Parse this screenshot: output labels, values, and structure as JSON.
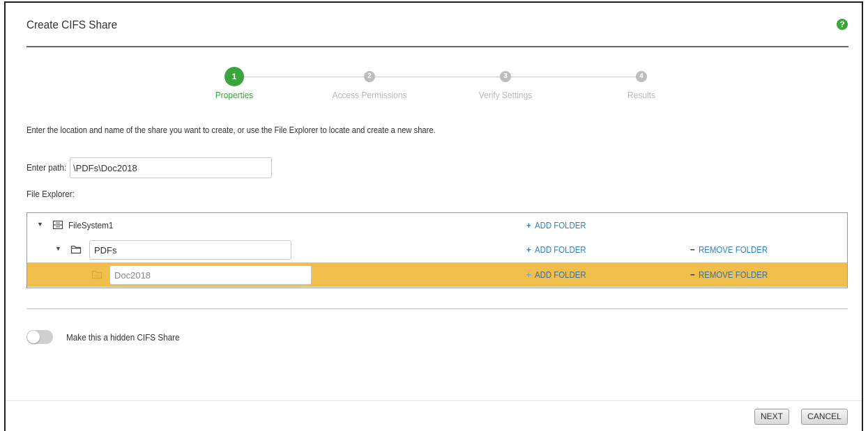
{
  "dialog": {
    "title": "Create CIFS Share",
    "help_icon": "question-icon",
    "help_symbol": "?"
  },
  "stepper": {
    "steps": [
      {
        "number": "1",
        "label": "Properties",
        "state": "active"
      },
      {
        "number": "2",
        "label": "Access Permissions",
        "state": "inactive"
      },
      {
        "number": "3",
        "label": "Verify Settings",
        "state": "inactive"
      },
      {
        "number": "4",
        "label": "Results",
        "state": "inactive"
      }
    ],
    "active_color": "#3aa53a",
    "inactive_color": "#bdbdbd"
  },
  "intro_text": "Enter the location and name of the share you want to create, or use the File Explorer to locate and create a new share.",
  "path": {
    "label": "Enter path:",
    "value": "\\PDFs\\Doc2018"
  },
  "file_explorer": {
    "label": "File Explorer:",
    "rows": [
      {
        "name": "FileSystem1",
        "icon": "filesystem-icon",
        "add_label": "ADD FOLDER",
        "remove_label": null
      },
      {
        "name": "PDFs",
        "icon": "folder-icon",
        "add_label": "ADD FOLDER",
        "remove_label": "REMOVE FOLDER"
      },
      {
        "name": "Doc2018",
        "icon": "share-folder-icon",
        "add_label": "ADD FOLDER",
        "remove_label": "REMOVE FOLDER",
        "selected": true
      }
    ],
    "add_symbol": "+",
    "remove_symbol": "−",
    "selected_color": "#f1be4c"
  },
  "hidden_share": {
    "label": "Make this a hidden CIFS Share",
    "enabled": false
  },
  "footer": {
    "next_label": "NEXT",
    "cancel_label": "CANCEL"
  }
}
